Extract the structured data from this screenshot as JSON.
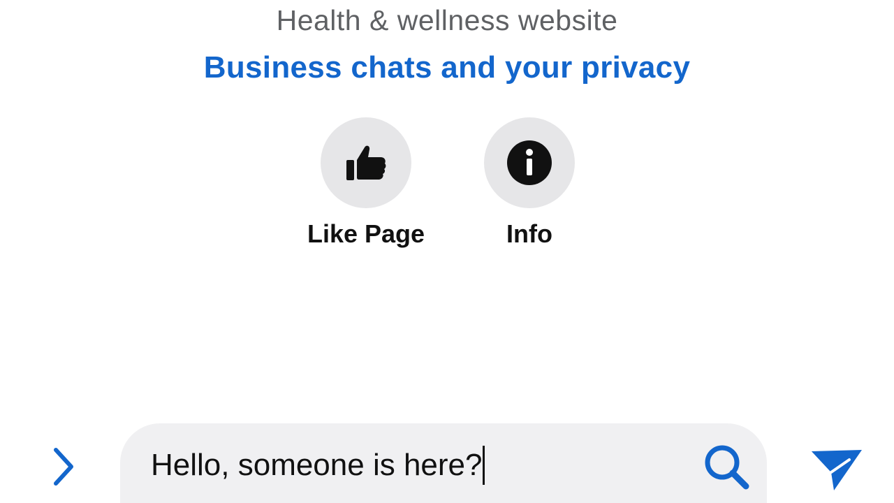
{
  "header": {
    "category": "Health & wellness website",
    "privacy_link": "Business chats and your privacy"
  },
  "actions": [
    {
      "label": "Like Page",
      "icon": "thumbs-up-icon"
    },
    {
      "label": "Info",
      "icon": "info-icon"
    }
  ],
  "composer": {
    "message_value": "Hello, someone is here?",
    "expand_icon": "chevron-right-icon",
    "search_icon": "search-icon",
    "send_icon": "send-icon"
  },
  "colors": {
    "accent": "#1366cc",
    "secondary_text": "#5f6164",
    "icon_circle_bg": "#e6e6e8",
    "input_bg": "#f0f0f2"
  }
}
